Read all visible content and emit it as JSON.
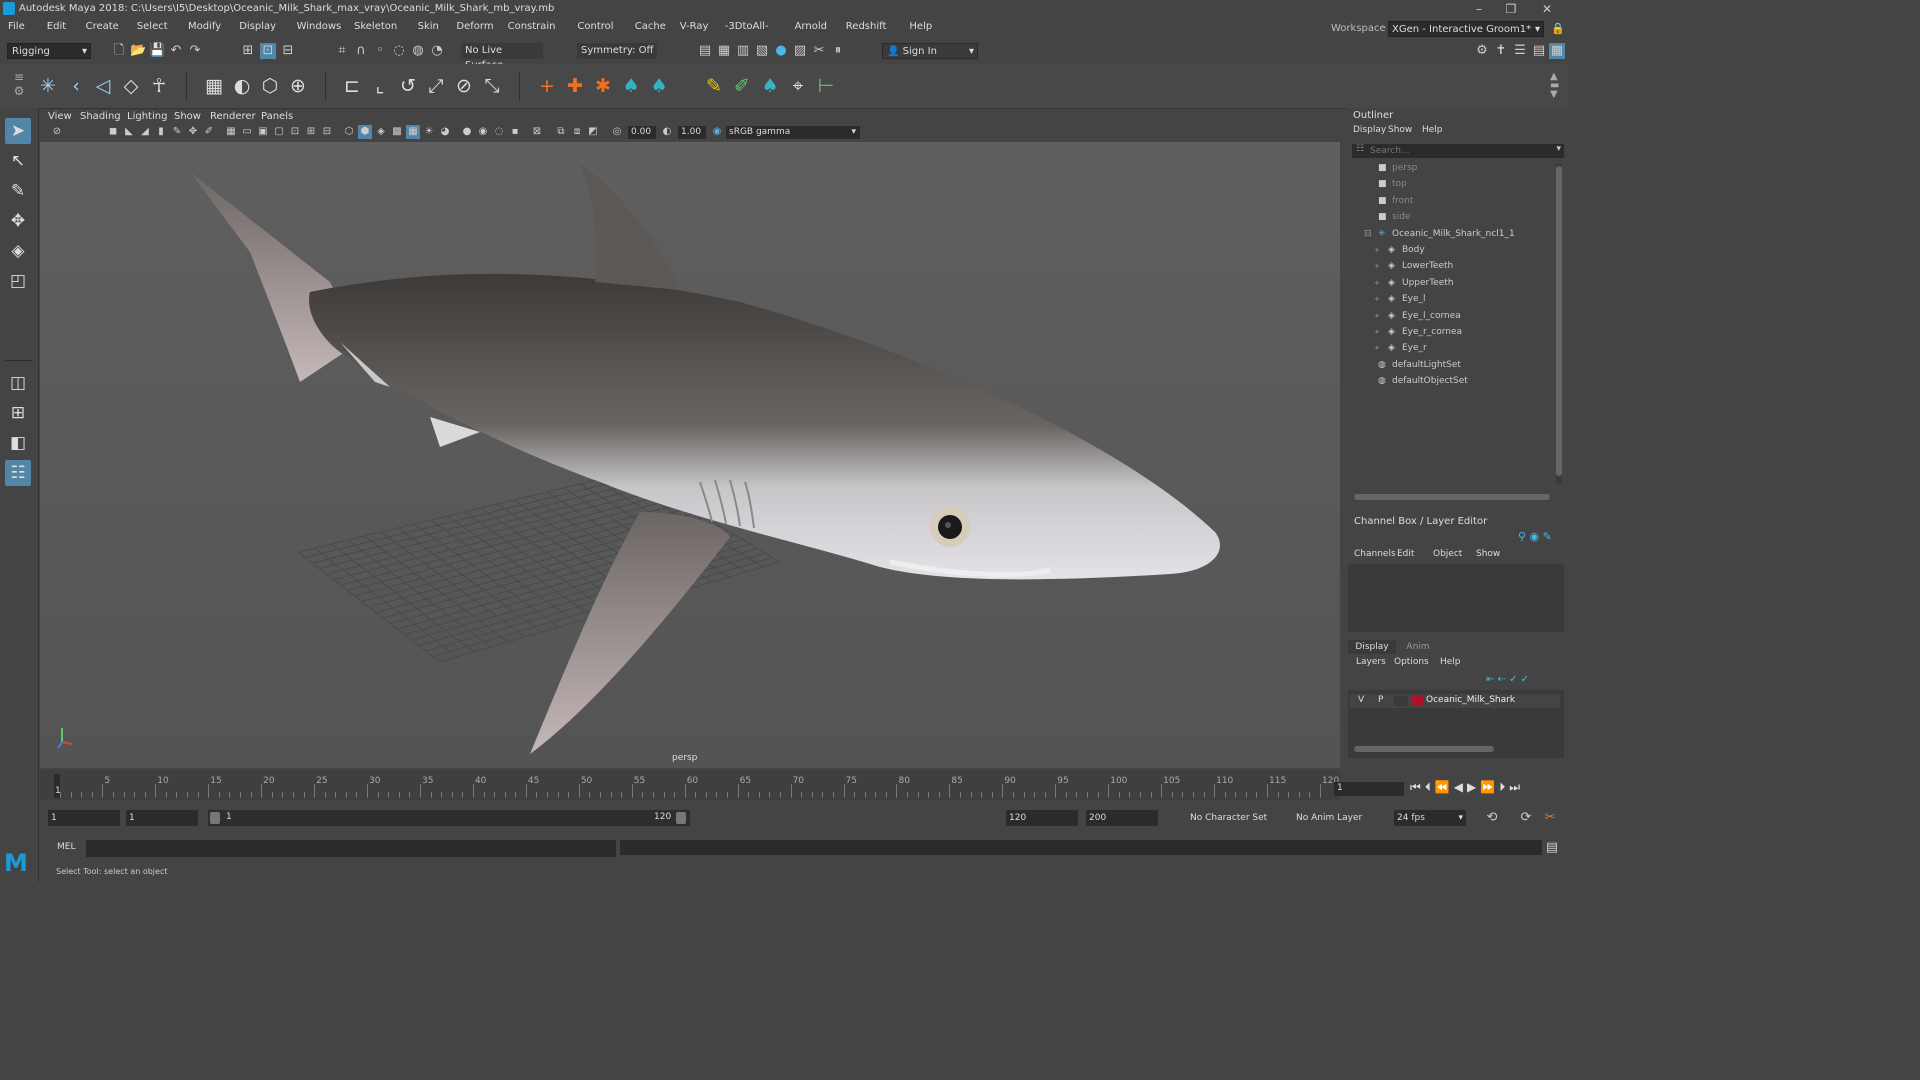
{
  "window": {
    "title": "Autodesk Maya 2018: C:\\Users\\I5\\Desktop\\Oceanic_Milk_Shark_max_vray\\Oceanic_Milk_Shark_mb_vray.mb",
    "minimize": "–",
    "maximize": "❐",
    "close": "✕"
  },
  "menu": [
    "File",
    "Edit",
    "Create",
    "Select",
    "Modify",
    "Display",
    "Windows",
    "Skeleton",
    "Skin",
    "Deform",
    "Constrain",
    "Control",
    "Cache",
    "V-Ray",
    "-3DtoAll-",
    "Arnold",
    "Redshift",
    "Help"
  ],
  "workspace": {
    "label": "Workspace :",
    "value": "XGen - Interactive Groom1*"
  },
  "status_line": {
    "menu_set": "Rigging",
    "live_surface": "No Live Surface",
    "symmetry": "Symmetry: Off",
    "sign_in": "Sign In"
  },
  "viewport": {
    "menus": [
      "View",
      "Shading",
      "Lighting",
      "Show",
      "Renderer",
      "Panels"
    ],
    "exposure": "0.00",
    "gamma": "1.00",
    "color_space": "sRGB gamma",
    "camera_label": "persp"
  },
  "outliner": {
    "title": "Outliner",
    "menus": [
      "Display",
      "Show",
      "Help"
    ],
    "search_placeholder": "Search...",
    "items": [
      {
        "label": "persp",
        "type": "camera",
        "indent": 0
      },
      {
        "label": "top",
        "type": "camera",
        "indent": 0
      },
      {
        "label": "front",
        "type": "camera",
        "indent": 0
      },
      {
        "label": "side",
        "type": "camera",
        "indent": 0
      },
      {
        "label": "Oceanic_Milk_Shark_ncl1_1",
        "type": "group",
        "indent": 0
      },
      {
        "label": "Body",
        "type": "mesh",
        "indent": 1
      },
      {
        "label": "LowerTeeth",
        "type": "mesh",
        "indent": 1
      },
      {
        "label": "UpperTeeth",
        "type": "mesh",
        "indent": 1
      },
      {
        "label": "Eye_l",
        "type": "mesh",
        "indent": 1
      },
      {
        "label": "Eye_l_cornea",
        "type": "mesh",
        "indent": 1
      },
      {
        "label": "Eye_r_cornea",
        "type": "mesh",
        "indent": 1
      },
      {
        "label": "Eye_r",
        "type": "mesh",
        "indent": 1
      },
      {
        "label": "defaultLightSet",
        "type": "set",
        "indent": 0
      },
      {
        "label": "defaultObjectSet",
        "type": "set",
        "indent": 0
      }
    ]
  },
  "channel_box": {
    "title": "Channel Box / Layer Editor",
    "menus": [
      "Channels",
      "Edit",
      "Object",
      "Show"
    ]
  },
  "layer_editor": {
    "tabs": [
      "Display",
      "Anim"
    ],
    "menus": [
      "Layers",
      "Options",
      "Help"
    ],
    "layer": {
      "v": "V",
      "p": "P",
      "name": "Oceanic_Milk_Shark",
      "color": "#b0102a"
    }
  },
  "timeline": {
    "ticks": [
      "5",
      "10",
      "15",
      "20",
      "25",
      "30",
      "35",
      "40",
      "45",
      "50",
      "55",
      "60",
      "65",
      "70",
      "75",
      "80",
      "85",
      "90",
      "95",
      "100",
      "105",
      "110",
      "115",
      "120"
    ],
    "current_marker": "1",
    "current_frame": "1"
  },
  "range": {
    "start": "1",
    "anim_start": "1",
    "slider_start": "1",
    "slider_end": "120",
    "end": "120",
    "anim_end": "200",
    "character_set": "No Character Set",
    "anim_layer": "No Anim Layer",
    "fps": "24 fps"
  },
  "command_line": {
    "label": "MEL"
  },
  "help_line": "Select Tool: select an object",
  "colors": {
    "accent": "#5285a6",
    "maya_logo": "#1a9bd7"
  }
}
